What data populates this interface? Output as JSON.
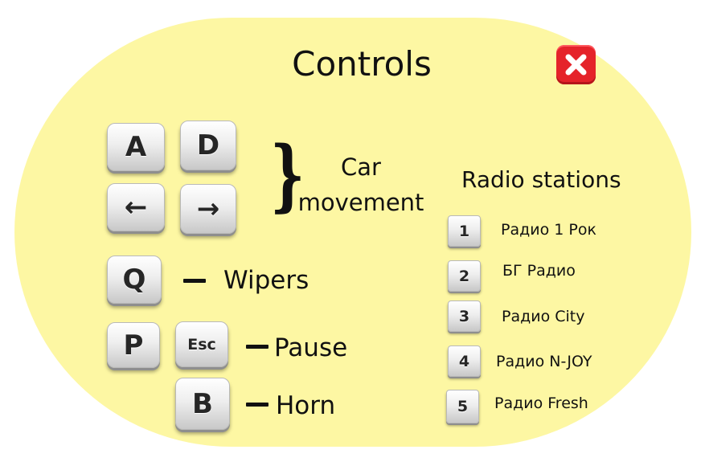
{
  "title": "Controls",
  "keys": {
    "a": "A",
    "d": "D",
    "left": "←",
    "right": "→",
    "q": "Q",
    "p": "P",
    "esc": "Esc",
    "b": "B"
  },
  "labels": {
    "car_line1": "Car",
    "car_line2": "movement",
    "wipers": "Wipers",
    "pause": "Pause",
    "horn": "Horn"
  },
  "radio": {
    "title": "Radio stations",
    "stations": [
      {
        "key": "1",
        "name": "Радио 1 Рок"
      },
      {
        "key": "2",
        "name": "БГ Радио"
      },
      {
        "key": "3",
        "name": "Радио City"
      },
      {
        "key": "4",
        "name": "Радио N-JOY"
      },
      {
        "key": "5",
        "name": "Радио Fresh"
      }
    ]
  },
  "colors": {
    "panel": "#fdf7a3",
    "close": "#e5232a"
  },
  "icons": {
    "close": "close-icon"
  }
}
